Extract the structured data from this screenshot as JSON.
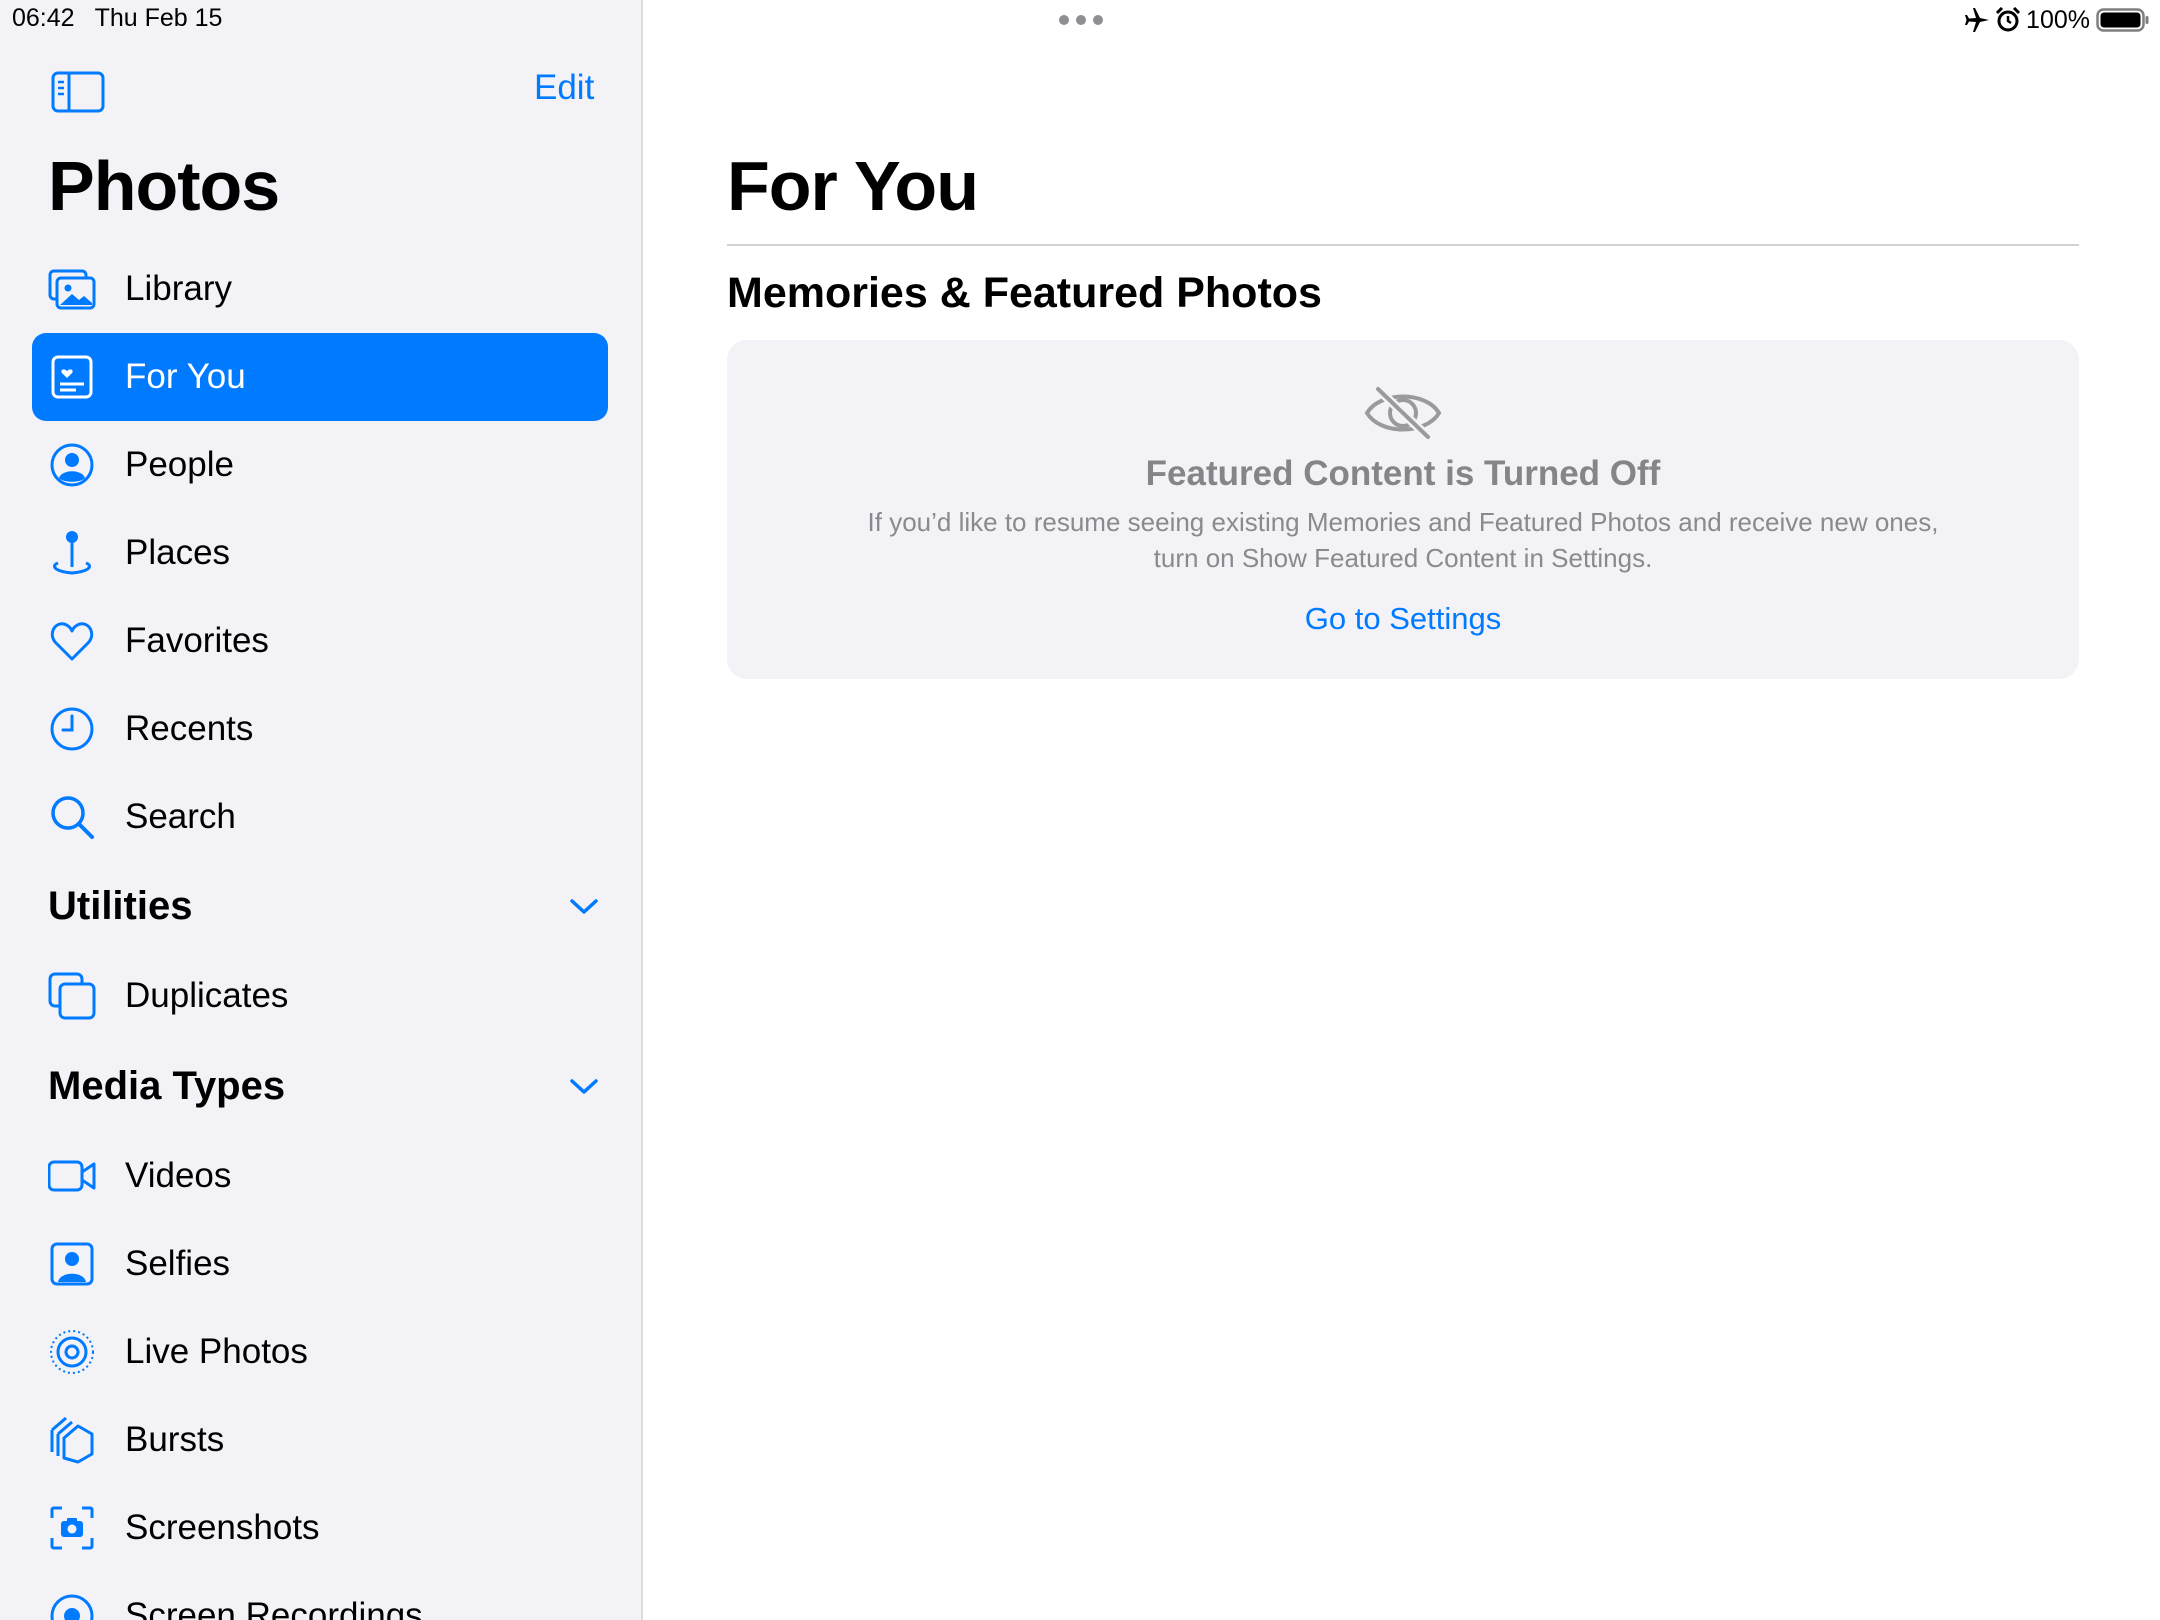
{
  "status_bar": {
    "time": "06:42",
    "date": "Thu Feb 15",
    "battery": "100%",
    "icons": [
      "airplane-icon",
      "alarm-icon",
      "battery-icon"
    ]
  },
  "sidebar": {
    "edit_label": "Edit",
    "title": "Photos",
    "items": [
      {
        "label": "Library",
        "icon": "library-icon"
      },
      {
        "label": "For You",
        "icon": "for-you-icon",
        "selected": true
      },
      {
        "label": "People",
        "icon": "person-icon"
      },
      {
        "label": "Places",
        "icon": "map-pin-icon"
      },
      {
        "label": "Favorites",
        "icon": "heart-icon"
      },
      {
        "label": "Recents",
        "icon": "clock-icon"
      },
      {
        "label": "Search",
        "icon": "search-icon"
      }
    ],
    "utilities": {
      "title": "Utilities",
      "items": [
        {
          "label": "Duplicates",
          "icon": "duplicates-icon"
        }
      ]
    },
    "media_types": {
      "title": "Media Types",
      "items": [
        {
          "label": "Videos",
          "icon": "video-icon"
        },
        {
          "label": "Selfies",
          "icon": "selfie-icon"
        },
        {
          "label": "Live Photos",
          "icon": "live-photo-icon"
        },
        {
          "label": "Bursts",
          "icon": "bursts-icon"
        },
        {
          "label": "Screenshots",
          "icon": "screenshot-icon"
        },
        {
          "label": "Screen Recordings",
          "icon": "screen-recording-icon"
        }
      ]
    }
  },
  "main": {
    "title": "For You",
    "section_title": "Memories & Featured Photos",
    "card": {
      "icon": "eye-slash-icon",
      "title": "Featured Content is Turned Off",
      "body": "If you’d like to resume seeing existing Memories and Featured Photos and receive new ones, turn on Show Featured Content in Settings.",
      "link": "Go to Settings"
    }
  },
  "colors": {
    "accent": "#007aff",
    "sidebar_bg": "#f2f2f7",
    "card_bg": "#f2f2f7"
  }
}
